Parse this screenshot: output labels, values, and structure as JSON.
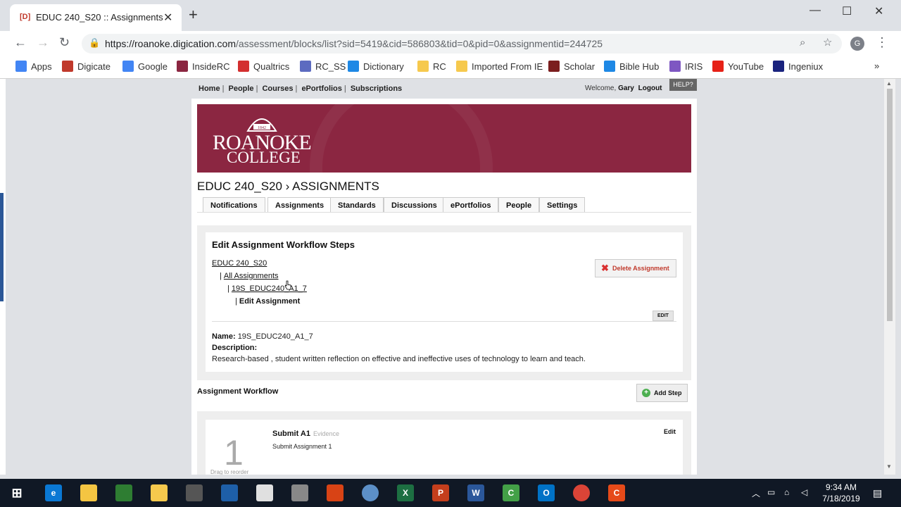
{
  "browser": {
    "tab_title": "EDUC 240_S20 :: Assignments",
    "tab_favicon": "[D]",
    "url_host": "https://roanoke.digication.com",
    "url_path": "/assessment/blocks/list?sid=5419&cid=586803&tid=0&pid=0&assignmentid=244725",
    "profile_initial": "G"
  },
  "bookmarks": [
    {
      "label": "Apps",
      "icon": "apps-grid-icon",
      "color": "#4285f4"
    },
    {
      "label": "Digicate",
      "icon": "digicate-icon",
      "color": "#c0392b"
    },
    {
      "label": "Google",
      "icon": "google-icon",
      "color": "#4285f4"
    },
    {
      "label": "InsideRC",
      "icon": "insiderc-icon",
      "color": "#8b2641"
    },
    {
      "label": "Qualtrics",
      "icon": "qualtrics-icon",
      "color": "#d32f2f"
    },
    {
      "label": "RC_SS",
      "icon": "rcss-icon",
      "color": "#5c6bc0"
    },
    {
      "label": "Dictionary",
      "icon": "dictionary-icon",
      "color": "#1e88e5"
    },
    {
      "label": "RC",
      "icon": "folder-icon",
      "color": "#f6c94d"
    },
    {
      "label": "Imported From IE",
      "icon": "folder-icon",
      "color": "#f6c94d"
    },
    {
      "label": "Scholar",
      "icon": "scholar-icon",
      "color": "#7b1e1e"
    },
    {
      "label": "Bible Hub",
      "icon": "biblehub-icon",
      "color": "#1e88e5"
    },
    {
      "label": "IRIS",
      "icon": "iris-icon",
      "color": "#7e57c2"
    },
    {
      "label": "YouTube",
      "icon": "youtube-icon",
      "color": "#e62117"
    },
    {
      "label": "Ingeniux",
      "icon": "ingeniux-icon",
      "color": "#1a237e"
    }
  ],
  "site_nav": {
    "links": [
      "Home",
      "People",
      "Courses",
      "ePortfolios",
      "Subscriptions"
    ],
    "welcome_prefix": "Welcome,",
    "user": "Gary",
    "logout": "Logout",
    "help": "HELP?"
  },
  "banner": {
    "line1": "ROANOKE",
    "line2": "COLLEGE",
    "seal_year": "1842"
  },
  "course": {
    "title": "EDUC 240_S20 › ASSIGNMENTS"
  },
  "tabs": [
    "Notifications",
    "Assignments",
    "Standards",
    "Discussions",
    "ePortfolios",
    "People",
    "Settings"
  ],
  "edit_panel": {
    "heading": "Edit Assignment Workflow Steps",
    "breadcrumb": [
      "EDUC 240_S20",
      "All Assignments",
      "19S_EDUC240_A1_7",
      "Edit Assignment"
    ],
    "delete_label": "Delete Assignment",
    "edit_small": "EDIT",
    "name_label": "Name:",
    "name_value": "19S_EDUC240_A1_7",
    "description_label": "Description:",
    "description_value": "Research-based , student written reflection on effective and ineffective uses of technology to learn and teach."
  },
  "workflow": {
    "label": "Assignment Workflow",
    "add_step": "Add Step",
    "steps": [
      {
        "number": "1",
        "title": "Submit A1",
        "type": "Evidence",
        "subtitle": "Submit Assignment 1",
        "edit": "Edit",
        "drag": "Drag to reorder"
      }
    ]
  },
  "taskbar": {
    "time": "9:34 AM",
    "date": "7/18/2019"
  }
}
